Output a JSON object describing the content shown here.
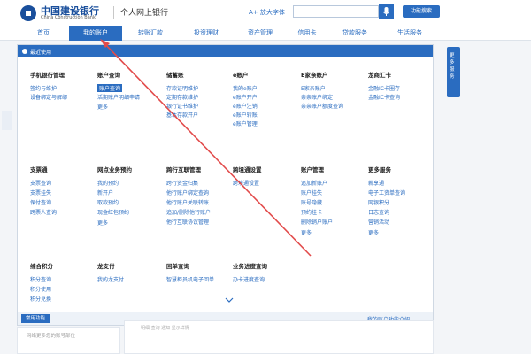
{
  "header": {
    "bank_name": "中国建设银行",
    "bank_name_en": "China Construction Bank",
    "site_title": "个人网上银行",
    "big_font": "A+ 放大字体",
    "func_search": "功能搜索"
  },
  "nav": [
    {
      "label": "首页"
    },
    {
      "label": "我的账户"
    },
    {
      "label": "转账汇款"
    },
    {
      "label": "投资理财"
    },
    {
      "label": "资产管理"
    },
    {
      "label": "信用卡"
    },
    {
      "label": "贷款服务"
    },
    {
      "label": "生活服务"
    }
  ],
  "panel": {
    "recent_label": "最近使用",
    "quick_btn": "常用功能",
    "intro_link": "我的账户功能介绍",
    "col1_title": "手机银行管理",
    "col1_items": [
      "签约与维护",
      "设备绑定与解绑"
    ],
    "col2_title": "账户查询",
    "col2_items": [
      "账户查询",
      "活期账户明细申请"
    ],
    "col3_title": "储蓄账",
    "col3_items": [
      "存款证明维护",
      "定期存款维护",
      "银行证书维护",
      "基本存款开户"
    ],
    "col4_title": "e账户",
    "col4_items": [
      "我的e账户",
      "e账户开户",
      "e账户注销",
      "e账户转账",
      "e账户管理"
    ],
    "col5_title": "E家亲账户",
    "col5_items": [
      "E家亲账户",
      "亲亲账户绑定",
      "亲亲账户额度查询"
    ],
    "col6_title": "龙商汇卡",
    "col6_items": [
      "金融IC卡圈存",
      "金融IC卡查询"
    ],
    "row2_col1_title": "支票通",
    "row2_col1_items": [
      "支票查询",
      "支票挂失",
      "保付查询",
      "跨票人查询"
    ],
    "row2_col2_title": "网点业务预约",
    "row2_col2_items": [
      "我的预约",
      "新开户",
      "取款预约",
      "现金红包预约"
    ],
    "row2_col3_title": "跨行互联管理",
    "row2_col3_items": [
      "跨行资金归集",
      "他行账户绑定查询",
      "他行账户关联转账",
      "追加/删除他行账户",
      "他行互联协议管理"
    ],
    "row2_col4_title": "跨境通设置",
    "row2_col4_items": [
      "跨境通设置"
    ],
    "row2_col5_title": "账户管理",
    "row2_col5_items": [
      "追加新账户",
      "账户挂失",
      "账号隐藏",
      "预约挂卡",
      "删除销户账户"
    ],
    "row2_col6_title": "更多服务",
    "row2_col6_items": [
      "薪享通",
      "电子工资单查询",
      "网银积分",
      "日志查询",
      "营销活动"
    ],
    "row3_col1_title": "综合积分",
    "row3_col1_items": [
      "积分查询",
      "积分使用",
      "积分兑换"
    ],
    "row3_col2_title": "龙支付",
    "row3_col2_items": [
      "我的龙支付"
    ],
    "row3_col3_title": "回单查询",
    "row3_col3_items": [
      "智慧柜员机电子回单"
    ],
    "row3_col4_title": "业务进度查询",
    "row3_col4_items": [
      "办卡进度查询"
    ],
    "more": "更多"
  },
  "side": {
    "right_text": "更多服务"
  },
  "bottom": {
    "left_text": "网络更多您的账号部位",
    "right_text": "明细    查询    通知    显示详情"
  },
  "colors": {
    "accent": "#2a6cc0",
    "arrow": "#e24b4b"
  }
}
